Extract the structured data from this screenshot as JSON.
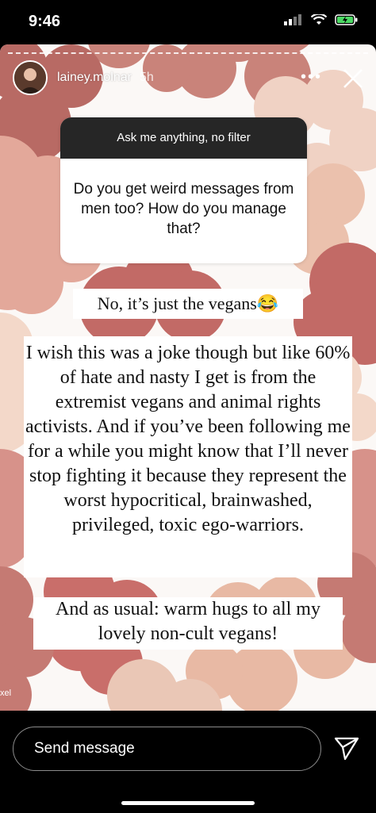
{
  "status_bar": {
    "time": "9:46"
  },
  "story": {
    "username": "lainey.molnar",
    "time_ago": "5h",
    "more_label": "•••",
    "question_sticker": {
      "header": "Ask me anything, no filter",
      "question": "Do you get weird messages from men too? How do you manage that?"
    },
    "captions": [
      "No, it’s just the vegans😂",
      "I wish this was a joke though but like 60% of hate and nasty I get is from the extremist vegans and animal rights activists. And if you’ve been following me for a while you might know that I’ll never stop fighting it because they represent the worst hypocritical, brainwashed, privileged, toxic ego-warriors.",
      "And as usual: warm hugs to all my lovely non-cult vegans!"
    ],
    "watermark": "xel"
  },
  "reply_bar": {
    "placeholder": "Send message"
  },
  "colors": {
    "flower_dark": "#c06f65",
    "flower_mid": "#d38d7f",
    "flower_light": "#ebc4b2",
    "background": "#fbf8f6",
    "question_header": "#262626"
  }
}
